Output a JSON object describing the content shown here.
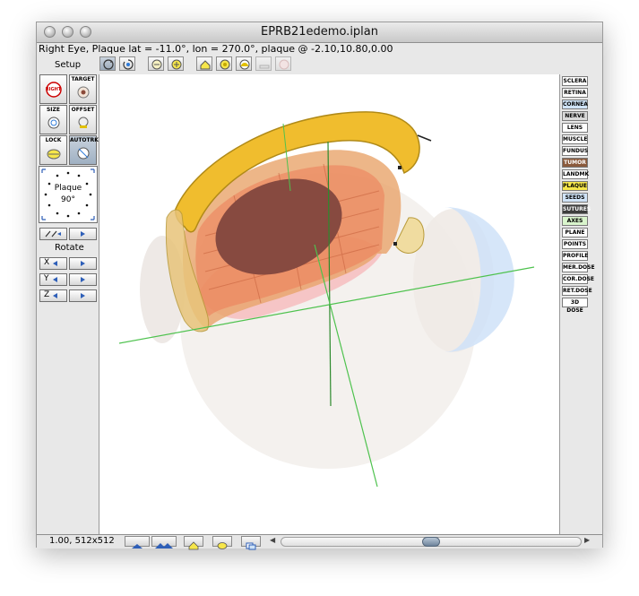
{
  "window": {
    "title": "EPRB21edemo.iplan",
    "status": "Right Eye, Plaque lat = -11.0°, lon = 270.0°, plaque @ -2.10,10.80,0.00"
  },
  "left_panel": {
    "setup_label": "Setup",
    "right_label": "RIGHT",
    "target_label": "TARGET",
    "size_label": "SIZE",
    "offset_label": "OFFSET",
    "lock_label": "LOCK",
    "autotrk_label": "AUTOTRK",
    "dial": {
      "name": "Plaque",
      "angle": "90°"
    },
    "rotate_label": "Rotate",
    "axes": [
      "X",
      "Y",
      "Z"
    ]
  },
  "layers": [
    {
      "label": "SCLERA",
      "color": "#ffffff"
    },
    {
      "label": "RETINA",
      "color": "#ffffff"
    },
    {
      "label": "CORNEA",
      "color": "#cfe3f7"
    },
    {
      "label": "NERVE",
      "color": "#d9d9d9"
    },
    {
      "label": "LENS",
      "color": "#ffffff"
    },
    {
      "label": "MUSCLE",
      "color": "#ffffff"
    },
    {
      "label": "FUNDUS",
      "color": "#ffffff"
    },
    {
      "label": "TUMOR",
      "color": "#8a5a3c"
    },
    {
      "label": "LANDMK",
      "color": "#ffffff"
    },
    {
      "label": "PLAQUE",
      "color": "#f5e64a"
    },
    {
      "label": "SEEDS",
      "color": "#cfe3f7"
    },
    {
      "label": "SUTURES",
      "color": "#3d3d3d"
    },
    {
      "label": "AXES",
      "color": "#d9f5cc"
    },
    {
      "label": "PLANE",
      "color": "#ffffff"
    },
    {
      "label": "POINTS",
      "color": "#ffffff"
    },
    {
      "label": "PROFILE",
      "color": "#ffffff"
    },
    {
      "label": "MER.DOSE",
      "color": "#ffffff"
    },
    {
      "label": "COR.DOSE",
      "color": "#ffffff"
    },
    {
      "label": "RET.DOSE",
      "color": "#ffffff"
    },
    {
      "label": "3D DOSE",
      "color": "#ffffff"
    }
  ],
  "bottom_bar": {
    "zoom": "1.00, 512x512"
  }
}
